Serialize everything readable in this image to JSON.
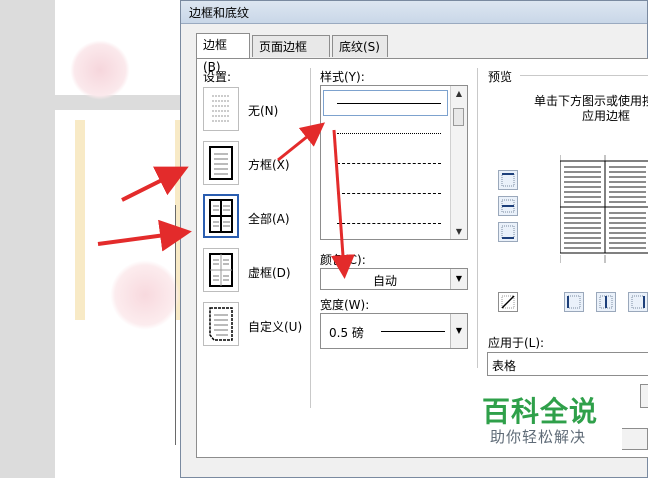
{
  "dialog": {
    "title": "边框和底纹",
    "tabs": [
      {
        "label": "边框(B)",
        "active": true
      },
      {
        "label": "页面边框(P)",
        "active": false
      },
      {
        "label": "底纹(S)",
        "active": false
      }
    ],
    "settings_label": "设置:",
    "settings": [
      {
        "label": "无(N)"
      },
      {
        "label": "方框(X)"
      },
      {
        "label": "全部(A)",
        "selected": true
      },
      {
        "label": "虚框(D)"
      },
      {
        "label": "自定义(U)"
      }
    ],
    "style_label": "样式(Y):",
    "color_label": "颜色(C):",
    "color_value": "自动",
    "width_label": "宽度(W):",
    "width_value": "0.5 磅",
    "preview_label": "预览",
    "preview_hint_1": "单击下方图示或使用按",
    "preview_hint_2": "应用边框",
    "apply_label": "应用于(L):",
    "apply_value": "表格"
  },
  "watermark": {
    "title": "百科全说",
    "subtitle": "助你轻松解决"
  },
  "colors": {
    "accent_blue": "#2a5db0",
    "arrow_red": "#e32b2b",
    "watermark_green": "#2fa04a"
  }
}
